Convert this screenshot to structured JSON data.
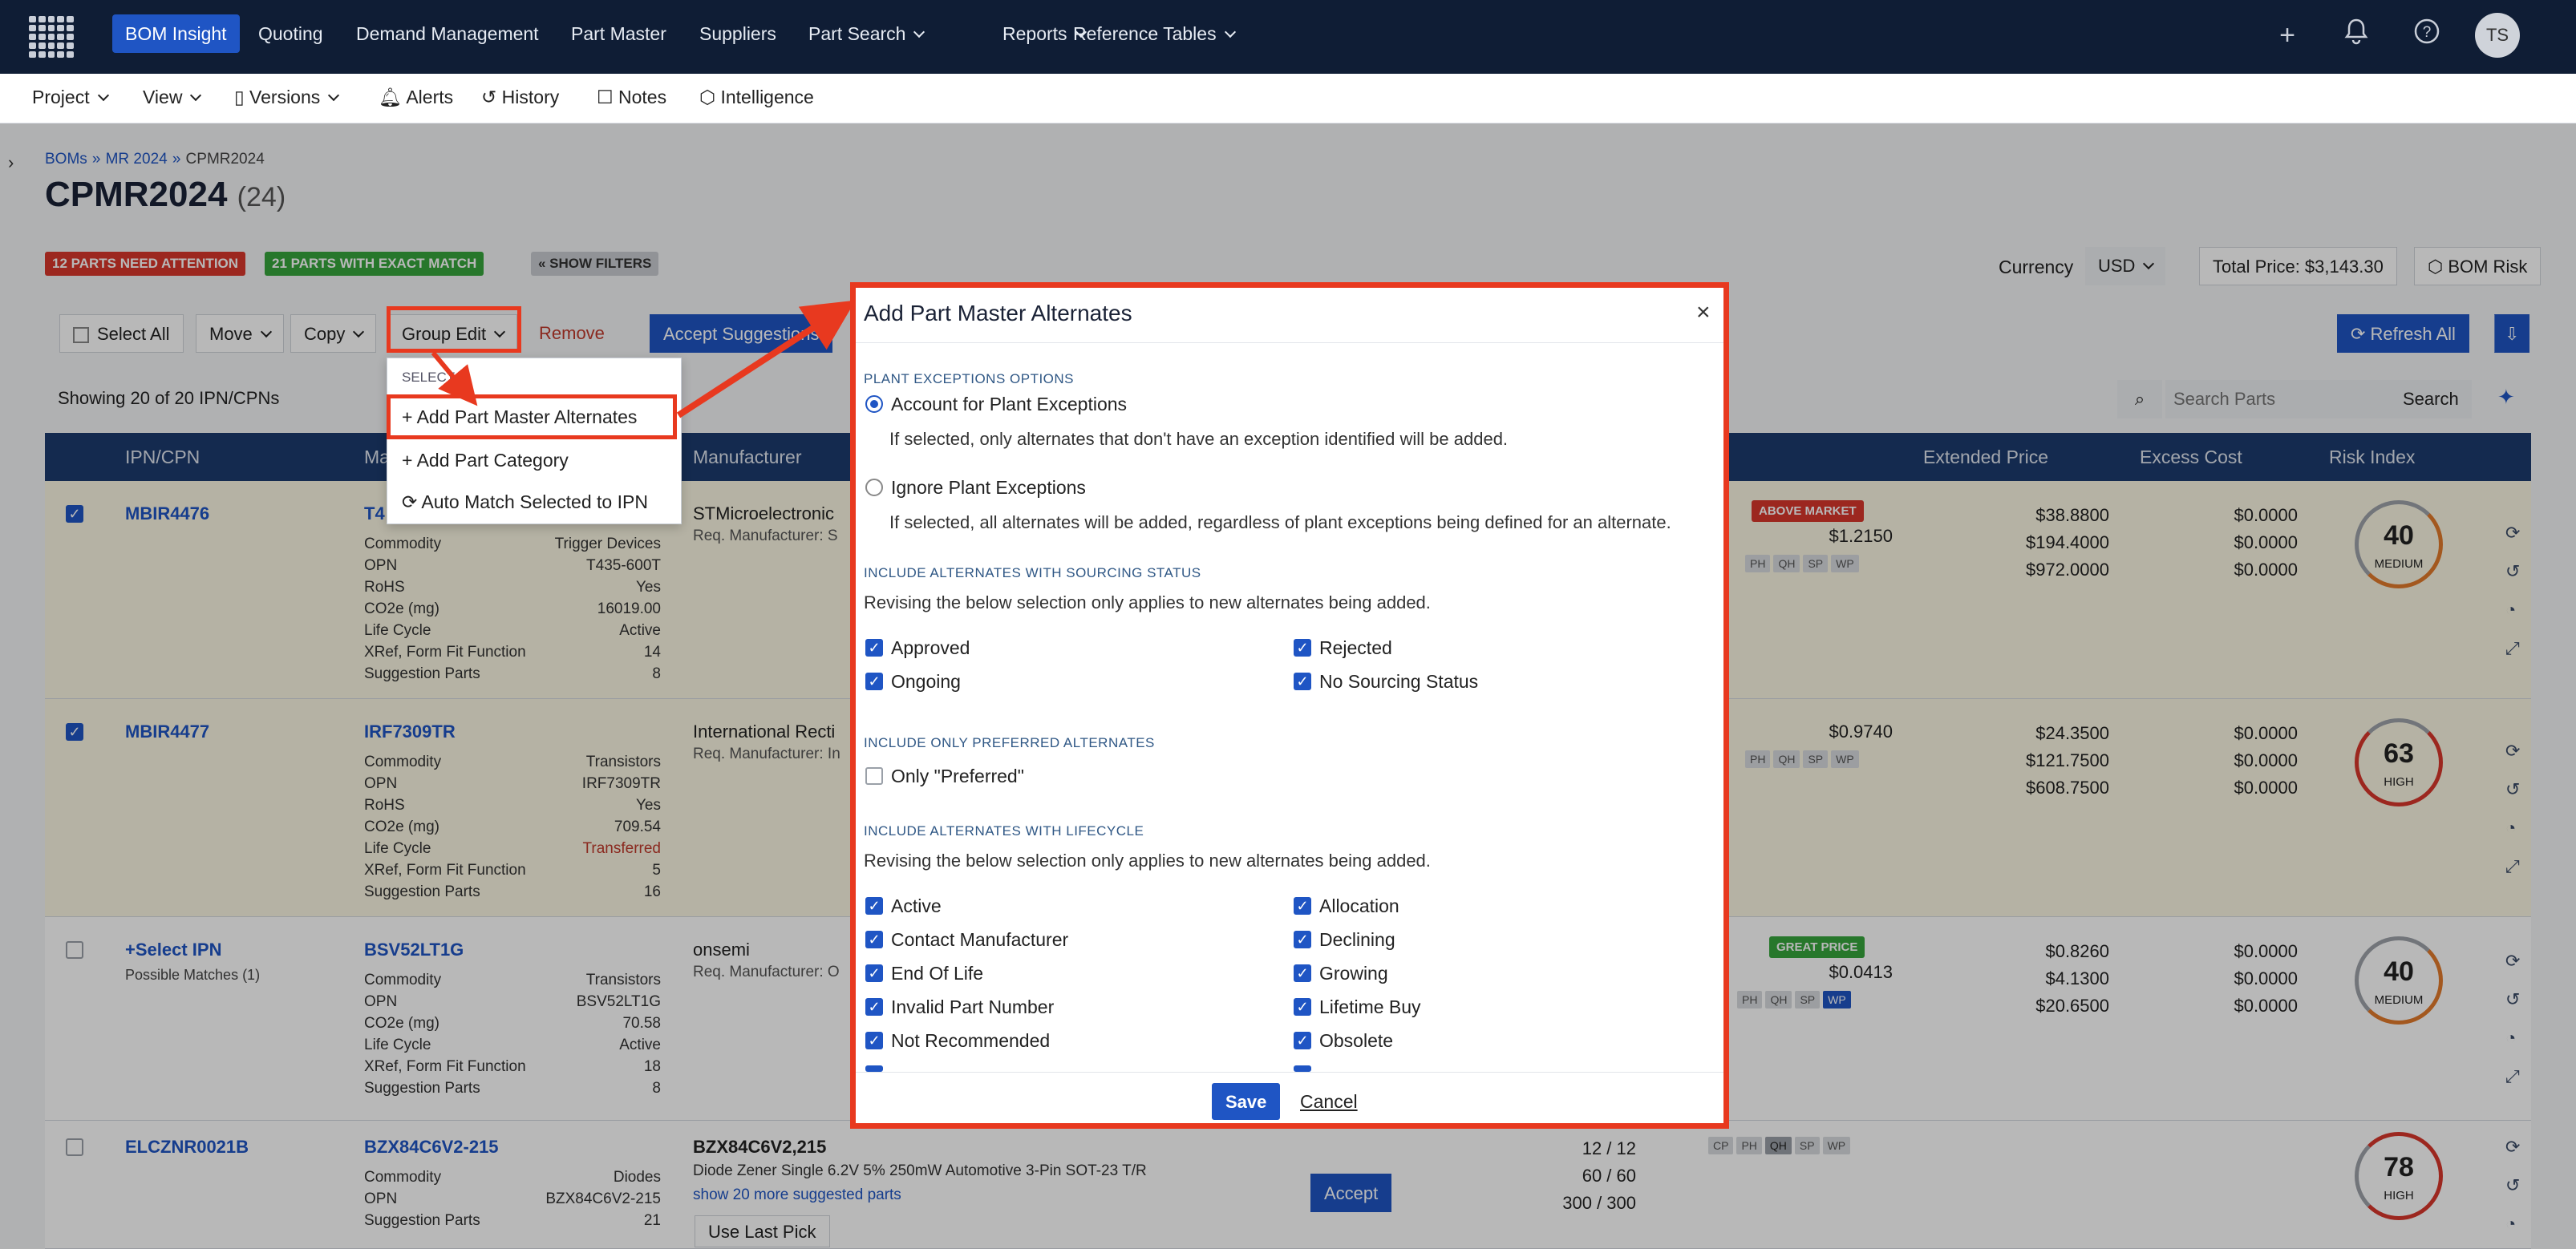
{
  "topnav": {
    "items": [
      "BOM Insight",
      "Quoting",
      "Demand Management",
      "Part Master",
      "Suppliers",
      "Part Search",
      "Reports",
      "Reference Tables"
    ],
    "avatar": "TS"
  },
  "subnav": {
    "items": [
      "Project",
      "View",
      "Versions",
      "Alerts",
      "History",
      "Notes",
      "Intelligence"
    ]
  },
  "breadcrumb": {
    "a": "BOMs",
    "sep": "»",
    "b": "MR 2024",
    "c": "CPMR2024"
  },
  "page": {
    "title": "CPMR2024",
    "count": "(24)"
  },
  "badges": {
    "attention": "12 PARTS NEED ATTENTION",
    "exact": "21 PARTS WITH EXACT MATCH",
    "filters": "« SHOW FILTERS"
  },
  "header_right": {
    "currency_label": "Currency",
    "currency": "USD",
    "total": "Total Price: $3,143.30",
    "risk": "BOM Risk"
  },
  "toolbar": {
    "select_all": "Select All",
    "move": "Move",
    "copy": "Copy",
    "group_edit": "Group Edit",
    "remove": "Remove",
    "accept": "Accept Suggestions",
    "refresh": "Refresh All"
  },
  "showing": "Showing 20 of 20 IPN/CPNs",
  "search": {
    "placeholder": "Search Parts",
    "button": "Search"
  },
  "columns": [
    "IPN/CPN",
    "Ma",
    "Manufacturer",
    "Extended Price",
    "Excess Cost",
    "Risk Index"
  ],
  "dropdown": {
    "header": "SELECT",
    "items": [
      "Add Part Master Alternates",
      "Add Part Category",
      "Auto Match Selected to IPN"
    ]
  },
  "rows": [
    {
      "ipn": "MBIR4476",
      "mpn": "T4",
      "manufacturer": "STMicroelectronic",
      "req": "Req. Manufacturer: S",
      "fields": [
        [
          "Commodity",
          "Trigger Devices"
        ],
        [
          "OPN",
          "T435-600T"
        ],
        [
          "RoHS",
          "Yes"
        ],
        [
          "CO2e (mg)",
          "16019.00"
        ],
        [
          "Life Cycle",
          "Active"
        ],
        [
          "XRef, Form Fit Function",
          "14"
        ],
        [
          "Suggestion Parts",
          "8"
        ]
      ],
      "flag": "ABOVE MARKET",
      "unit": "$1.2150",
      "ext": [
        "$38.8800",
        "$194.4000",
        "$972.0000"
      ],
      "excess": [
        "$0.0000",
        "$0.0000",
        "$0.0000"
      ],
      "risk": "40",
      "risk_label": "MEDIUM"
    },
    {
      "ipn": "MBIR4477",
      "mpn": "IRF7309TR",
      "manufacturer": "International Recti",
      "req": "Req. Manufacturer: In",
      "fields": [
        [
          "Commodity",
          "Transistors"
        ],
        [
          "OPN",
          "IRF7309TR"
        ],
        [
          "RoHS",
          "Yes"
        ],
        [
          "CO2e (mg)",
          "709.54"
        ],
        [
          "Life Cycle",
          "Transferred"
        ],
        [
          "XRef, Form Fit Function",
          "5"
        ],
        [
          "Suggestion Parts",
          "16"
        ]
      ],
      "unit": "$0.9740",
      "ext": [
        "$24.3500",
        "$121.7500",
        "$608.7500"
      ],
      "excess": [
        "$0.0000",
        "$0.0000",
        "$0.0000"
      ],
      "risk": "63",
      "risk_label": "HIGH"
    },
    {
      "ipn": "+Select IPN",
      "possible": "Possible Matches (1)",
      "mpn": "BSV52LT1G",
      "manufacturer": "onsemi",
      "req": "Req. Manufacturer: O",
      "fields": [
        [
          "Commodity",
          "Transistors"
        ],
        [
          "OPN",
          "BSV52LT1G"
        ],
        [
          "CO2e (mg)",
          "70.58"
        ],
        [
          "Life Cycle",
          "Active"
        ],
        [
          "XRef, Form Fit Function",
          "18"
        ],
        [
          "Suggestion Parts",
          "8"
        ]
      ],
      "flag": "GREAT PRICE",
      "unit": "$0.0413",
      "unit2": "$0.8260",
      "ext": [
        "$0.8260",
        "$4.1300",
        "$20.6500"
      ],
      "excess": [
        "$0.0000",
        "$0.0000",
        "$0.0000"
      ],
      "risk": "40",
      "risk_label": "MEDIUM"
    },
    {
      "ipn": "ELCZNR0021B",
      "mpn": "BZX84C6V2-215",
      "manufacturer": "BZX84C6V2,215",
      "req": "Diode Zener Single 6.2V 5% 250mW Automotive 3-Pin SOT-23 T/R",
      "more": "show 20 more suggested parts",
      "accept": "Accept",
      "last_pick": "Use Last Pick",
      "fields": [
        [
          "Commodity",
          "Diodes"
        ],
        [
          "OPN",
          "BZX84C6V2-215"
        ],
        [
          "Suggestion Parts",
          "21"
        ]
      ],
      "qty": [
        "12 / 12",
        "60 / 60",
        "300 / 300"
      ],
      "risk": "78",
      "risk_label": "HIGH"
    }
  ],
  "chips": [
    "CP",
    "PH",
    "QH",
    "SP",
    "WP"
  ],
  "modal": {
    "title": "Add Part Master Alternates",
    "close": "×",
    "plant_section": "PLANT EXCEPTIONS OPTIONS",
    "radio1": "Account for Plant Exceptions",
    "radio1_desc": "If selected, only alternates that don't have an exception identified will be added.",
    "radio2": "Ignore Plant Exceptions",
    "radio2_desc": "If selected, all alternates will be added, regardless of plant exceptions being defined for an alternate.",
    "sourcing_section": "INCLUDE ALTERNATES WITH SOURCING STATUS",
    "sourcing_desc": "Revising the below selection only applies to new alternates being added.",
    "sourcing": [
      "Approved",
      "Rejected",
      "Ongoing",
      "No Sourcing Status"
    ],
    "preferred_section": "INCLUDE ONLY PREFERRED ALTERNATES",
    "preferred": "Only \"Preferred\"",
    "lifecycle_section": "INCLUDE ALTERNATES WITH LIFECYCLE",
    "lifecycle_desc": "Revising the below selection only applies to new alternates being added.",
    "lifecycle": [
      "Active",
      "Allocation",
      "Contact Manufacturer",
      "Declining",
      "End Of Life",
      "Growing",
      "Invalid Part Number",
      "Lifetime Buy",
      "Not Recommended",
      "Obsolete"
    ],
    "save": "Save",
    "cancel": "Cancel"
  },
  "colors": {
    "nav_bg": "#0f1d35",
    "accent": "#1f55c4",
    "highlight": "#e8391f",
    "header_bg": "#1d3b6e"
  }
}
